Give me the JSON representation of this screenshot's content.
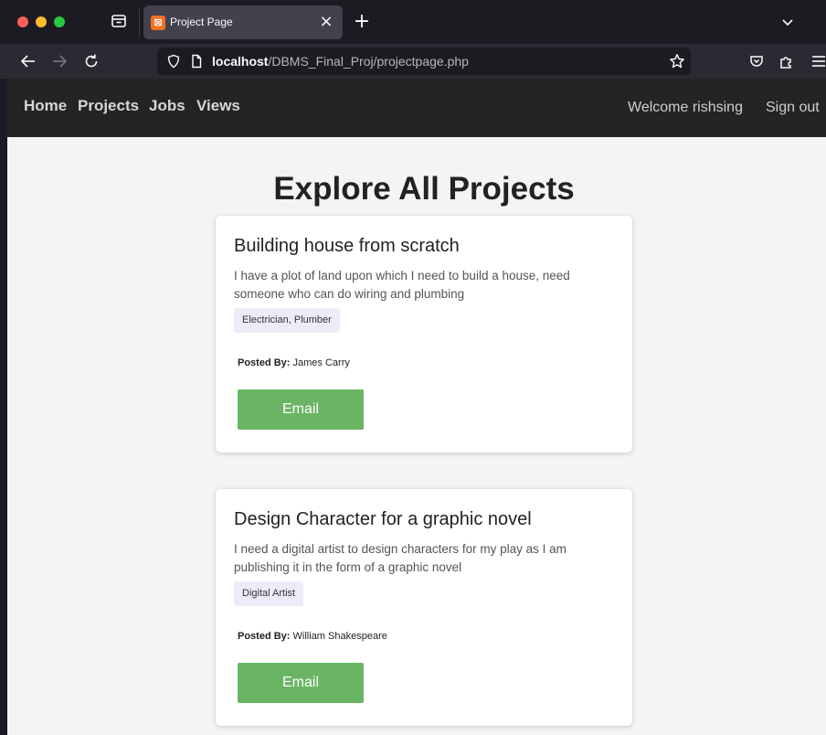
{
  "browser": {
    "tab_title": "Project Page",
    "tab_favicon_glyph": "⊠",
    "url_host": "localhost",
    "url_path": "/DBMS_Final_Proj/projectpage.php",
    "icons": [
      "tab-list-icon",
      "close-icon",
      "plus-icon",
      "chevron-down-icon",
      "back-arrow-icon",
      "forward-arrow-icon",
      "reload-icon",
      "shield-icon",
      "page-icon",
      "star-icon",
      "pocket-icon",
      "extensions-icon",
      "menu-icon"
    ]
  },
  "header": {
    "nav": [
      "Home",
      "Projects",
      "Jobs",
      "Views"
    ],
    "welcome": "Welcome rishsing",
    "signout": "Sign out"
  },
  "main": {
    "title": "Explore All Projects",
    "posted_by_label": "Posted By:",
    "projects": [
      {
        "title": "Building house from scratch",
        "description": "I have a plot of land upon which I need to build a house, need someone who can do wiring and plumbing",
        "skills": "Electrician, Plumber",
        "posted_by": "James Carry",
        "email_label": "Email"
      },
      {
        "title": "Design Character for a graphic novel",
        "description": "I need a digital artist to design characters for my play as I am publishing it in the form of a graphic novel",
        "skills": "Digital Artist",
        "posted_by": "William Shakespeare",
        "email_label": "Email"
      }
    ]
  },
  "colors": {
    "chrome_dark": "#1c1b22",
    "chrome_toolbar": "#2b2a33",
    "header_bg": "#242424",
    "page_bg": "#f4f4f4",
    "email_button": "#6ab564",
    "skill_tag": "#ececf9"
  }
}
